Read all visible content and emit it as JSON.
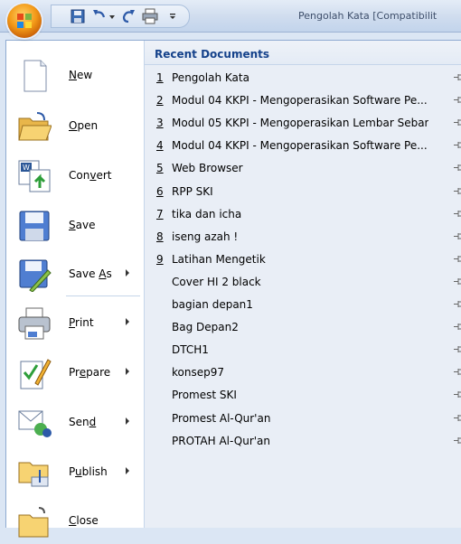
{
  "window": {
    "title": "Pengolah Kata [Compatibilit"
  },
  "quick_access": [
    {
      "name": "save-icon"
    },
    {
      "name": "undo-icon"
    },
    {
      "name": "undo-dropdown-icon"
    },
    {
      "name": "redo-icon"
    },
    {
      "name": "print-preview-icon"
    },
    {
      "name": "customize-dropdown-icon"
    }
  ],
  "commands": [
    {
      "label": "New",
      "icon": "new-document-icon",
      "has_submenu": false
    },
    {
      "label": "Open",
      "icon": "open-folder-icon",
      "has_submenu": false
    },
    {
      "label": "Convert",
      "icon": "convert-icon",
      "has_submenu": false
    },
    {
      "label": "Save",
      "icon": "save-icon",
      "has_submenu": false
    },
    {
      "label": "Save As",
      "icon": "save-as-icon",
      "has_submenu": true
    },
    {
      "label": "Print",
      "icon": "printer-icon",
      "has_submenu": true
    },
    {
      "label": "Prepare",
      "icon": "prepare-icon",
      "has_submenu": true
    },
    {
      "label": "Send",
      "icon": "send-icon",
      "has_submenu": true
    },
    {
      "label": "Publish",
      "icon": "publish-icon",
      "has_submenu": true
    },
    {
      "label": "Close",
      "icon": "close-folder-icon",
      "has_submenu": false
    }
  ],
  "recent": {
    "header": "Recent Documents",
    "documents": [
      {
        "num": "1",
        "name": "Pengolah Kata"
      },
      {
        "num": "2",
        "name": "Modul  04 KKPI - Mengoperasikan Software Pe..."
      },
      {
        "num": "3",
        "name": "Modul 05 KKPI - Mengoperasikan Lembar Sebar"
      },
      {
        "num": "4",
        "name": "Modul  04 KKPI - Mengoperasikan Software Pe..."
      },
      {
        "num": "5",
        "name": "Web Browser"
      },
      {
        "num": "6",
        "name": "RPP SKI"
      },
      {
        "num": "7",
        "name": "tika dan icha"
      },
      {
        "num": "8",
        "name": "iseng azah !"
      },
      {
        "num": "9",
        "name": "Latihan Mengetik"
      },
      {
        "num": "",
        "name": "Cover HI 2 black"
      },
      {
        "num": "",
        "name": "bagian depan1"
      },
      {
        "num": "",
        "name": "Bag Depan2"
      },
      {
        "num": "",
        "name": "DTCH1"
      },
      {
        "num": "",
        "name": "konsep97"
      },
      {
        "num": "",
        "name": "Promest SKI"
      },
      {
        "num": "",
        "name": "Promest Al-Qur'an"
      },
      {
        "num": "",
        "name": "PROTAH Al-Qur'an"
      }
    ]
  }
}
